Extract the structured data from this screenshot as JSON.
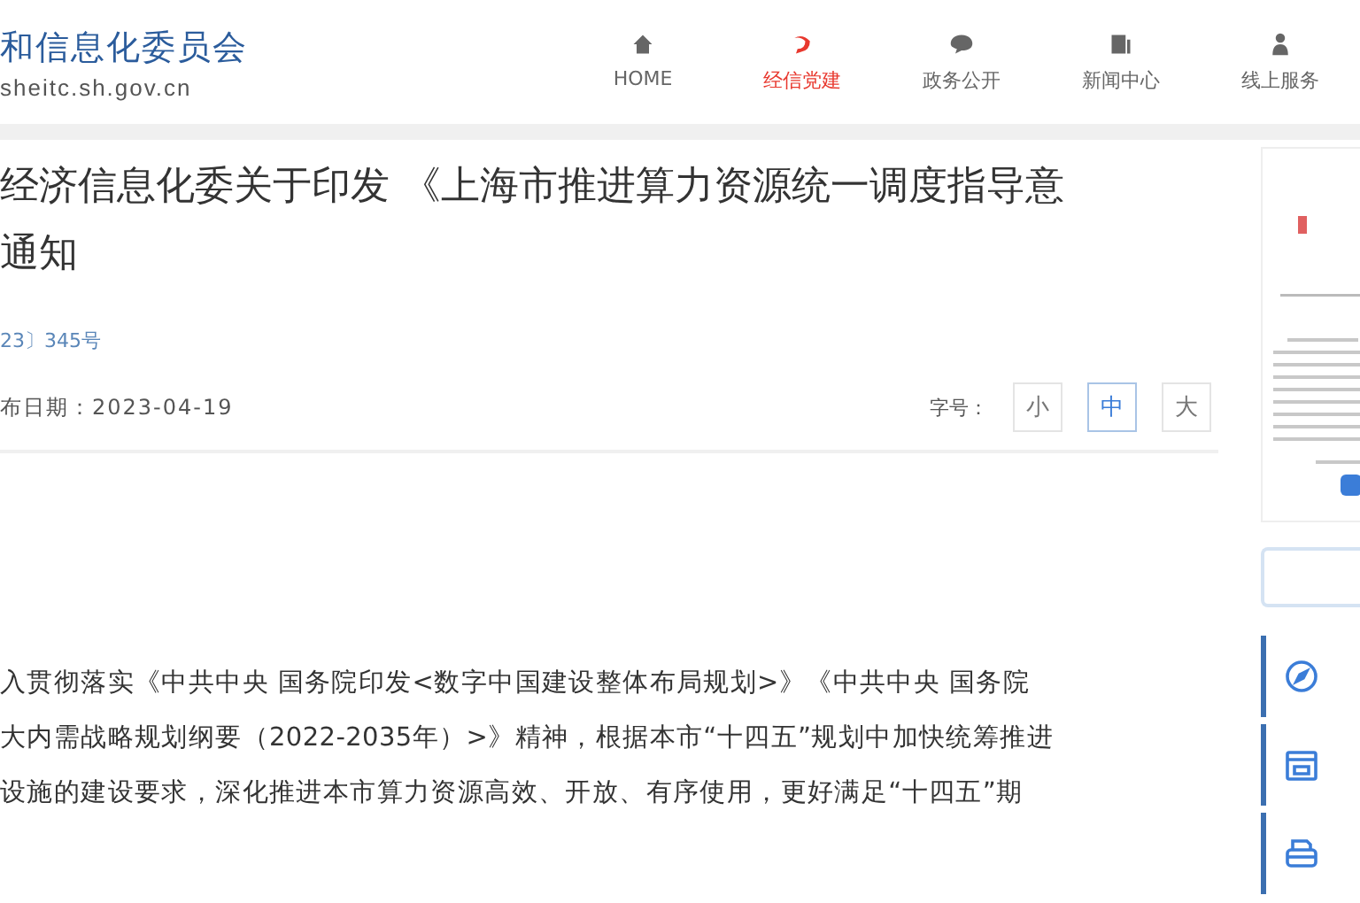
{
  "header": {
    "logo_name": "和信息化委员会",
    "logo_url": "sheitc.sh.gov.cn",
    "nav": [
      {
        "label": "HOME",
        "selected": false
      },
      {
        "label": "经信党建",
        "selected": true
      },
      {
        "label": "政务公开",
        "selected": false
      },
      {
        "label": "新闻中心",
        "selected": false
      },
      {
        "label": "线上服务",
        "selected": false
      }
    ]
  },
  "article": {
    "title_lines": [
      "经济信息化委关于印发 《上海市推进算力资源统一调度指导意",
      "通知"
    ],
    "doc_number": "23〕345号",
    "date": "布日期：2023-04-19",
    "font_size": {
      "label": "字号：",
      "options": [
        {
          "label": "小",
          "selected": false
        },
        {
          "label": "中",
          "selected": true
        },
        {
          "label": "大",
          "selected": false
        }
      ]
    },
    "body_lines": [
      "入贯彻落实《中共中央 国务院印发<数字中国建设整体布局规划>》《中共中央 国务院",
      "大内需战略规划纲要（2022-2035年）>》精神，根据本市“十四五”规划中加快统筹推进",
      "设施的建设要求，深化推进本市算力资源高效、开放、有序使用，更好满足“十四五”期"
    ]
  }
}
